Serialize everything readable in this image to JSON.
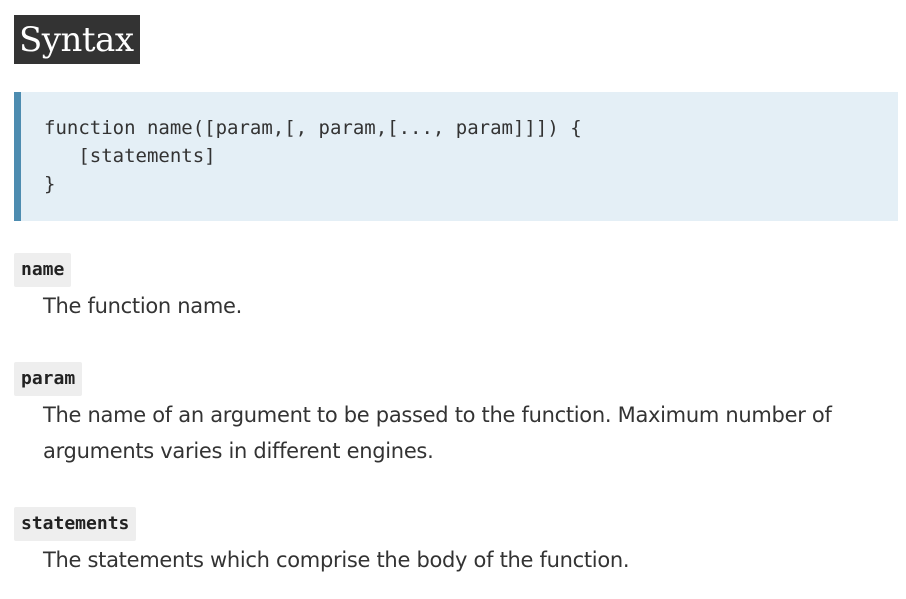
{
  "section": {
    "heading": "Syntax"
  },
  "code": {
    "line1": "function name([param,[, param,[..., param]]]) {",
    "line2": "   [statements]",
    "line3": "}"
  },
  "params": [
    {
      "term": "name",
      "description": "The function name."
    },
    {
      "term": "param",
      "description": "The name of an argument to be passed to the function. Maximum number of arguments varies in different engines."
    },
    {
      "term": "statements",
      "description": "The statements which comprise the body of the function."
    }
  ]
}
